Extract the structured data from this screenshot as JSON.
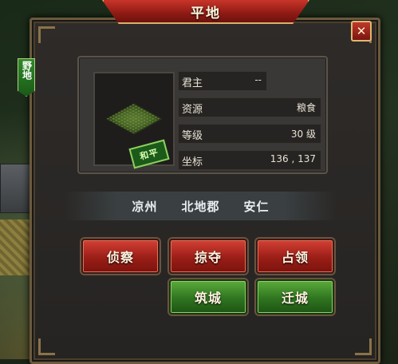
{
  "window": {
    "title": "平地",
    "close_icon": "✕"
  },
  "tile": {
    "type_tag": "野地",
    "status_badge": "和平",
    "colors": {
      "tag_bg": "#2f8a2a",
      "badge_bg": "#1c5a1a"
    }
  },
  "info": {
    "lord": {
      "label": "君主",
      "value": "--"
    },
    "resource": {
      "label": "资源",
      "value": "粮食"
    },
    "level": {
      "label": "等级",
      "value": "30 级"
    },
    "coords": {
      "label": "坐标",
      "value": "136 , 137"
    }
  },
  "location": {
    "province": "凉州",
    "commandery": "北地郡",
    "county": "安仁"
  },
  "actions": {
    "scout": "侦察",
    "plunder": "掠夺",
    "occupy": "占领",
    "build_city": "筑城",
    "relocate_city": "迁城"
  },
  "colors": {
    "red_button": "#9a1e17",
    "green_button": "#2f7420",
    "title_banner": "#8e1a14",
    "frame_gold": "#d9b06a"
  }
}
